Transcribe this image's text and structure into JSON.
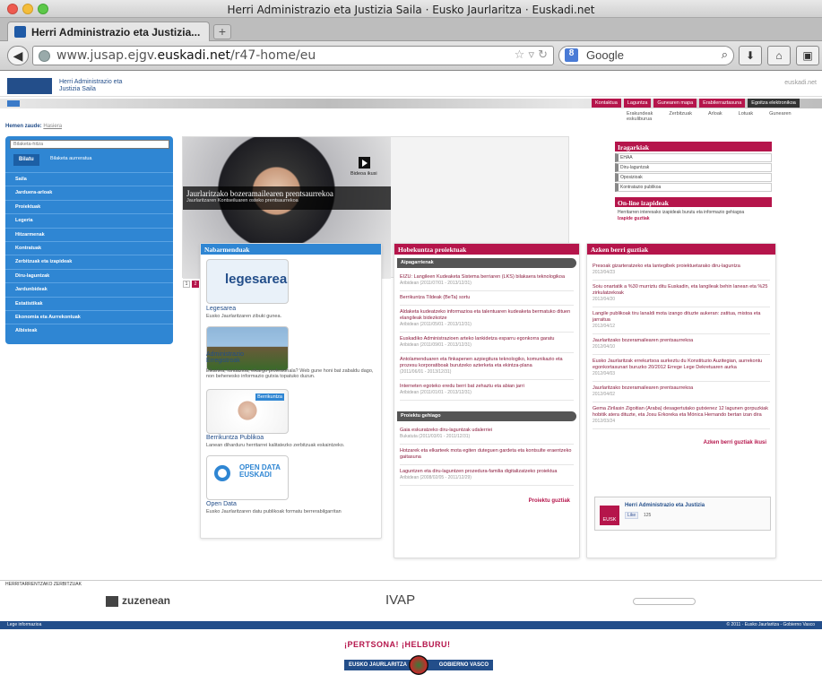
{
  "window": {
    "title": "Herri Administrazio eta Justizia Saila · Eusko Jaurlaritza · Euskadi.net"
  },
  "tab": {
    "label": "Herri Administrazio eta Justizia...",
    "new": "+"
  },
  "nav": {
    "url_prefix": "www.jusap.ejgv.",
    "url_domain": "euskadi.net",
    "url_path": "/r47-home/eu",
    "search_engine": "Google"
  },
  "header": {
    "org_name": "Herri Administrazio eta Justizia Saila",
    "brand_right": "euskadi.net"
  },
  "topnav": [
    "Kontaktua",
    "Laguntza",
    "Gunearen mapa",
    "Erabilerraztasuna",
    "Egoitza elektronikoa"
  ],
  "subnav": [
    "Erakundeak",
    "Zerbitzuak",
    "Arloak",
    "Lotuak",
    "Gunearen eskuliburua"
  ],
  "breadcrumb": {
    "label": "Hemen zaude:",
    "current": "Hasiera"
  },
  "sidebar": {
    "search_placeholder": "Bilaketa-hitza",
    "search_button": "Bilatu",
    "advanced": "Bilaketa aurreratua",
    "items": [
      "Saila",
      "Jarduera-arloak",
      "Proiektuak",
      "Legeria",
      "Hitzarmenak",
      "Kontratuak",
      "Zerbitzuak eta izapideak",
      "Diru-laguntzak",
      "Jardunbideak",
      "Estatistikak",
      "Ekonomia eta Aurrekontuak",
      "Albisteak"
    ]
  },
  "hero": {
    "title": "Jaurlaritzako bozeramailearen prentsaurrekoa",
    "subtitle": "Jaurlaritzaren Kontseiluaren osteko prentsaurrekoa",
    "video_label": "Bideoa ikusi",
    "pages": [
      "1",
      "2"
    ]
  },
  "right_panel": {
    "title1": "Iragarkiak",
    "items": [
      "EHAA",
      "Diru-laguntzak",
      "Oposizioak",
      "Kontratazio publikoa"
    ],
    "title2": "On-line izapideak",
    "online_text": "Herritarren interesako izapideak burutu eta informazio gehiagoa",
    "online_link": "Izapide guztiak"
  },
  "col1": {
    "title": "Nabarmenduak",
    "entries": [
      {
        "logo": "legesarea",
        "title": "Legesarea",
        "desc": "Eusko Jaurlaritzaren zibuki gunea."
      },
      {
        "title": "Administrazio Erregistroak",
        "desc": "Elkartea, fundazioa, elkargo profesionala? Web gune honi bat zabaldu dago, non behenesko informazio gutxia topatuko duzun."
      },
      {
        "tag": "Berrikuntza",
        "title": "Berrikuntza Publikoa",
        "desc": "Lanean diharduru herritarrei kalitatezko zerbitzuak eskaintzeko."
      },
      {
        "logo1": "OPEN DATA",
        "logo2": "EUSKADI",
        "title": "Open Data",
        "desc": "Eusko Jaurlaritzaren datu publikoak formatu berrerabilgarritan"
      }
    ]
  },
  "col2": {
    "title": "Hobekuntza proiektuak",
    "sub1": "Aipagarrienak",
    "items1": [
      {
        "text": "EIZU: Langileen Kudeaketa Sistema berriaren (LKS) bilakaera teknologikoa",
        "date": "Aribidean (2011/07/01 - 2013/12/31)"
      },
      {
        "text": "Berrikuntza Tildeak (BeTa) sortu",
        "date": ""
      },
      {
        "text": "Aldaketa kudeatzeko informazioa eta talentuaren kudeaketa bermatuko dituen elangileak bidezkotze",
        "date": "Aribidean (2011/05/01 - 2013/12/31)"
      },
      {
        "text": "Euskadiko Administrazioen arteko lankidetza esparru egonkorra garatu",
        "date": "Aribidean (2011/09/01 - 2013/12/31)"
      },
      {
        "text": "Antolamenduaren eta finkapenen azpiegitura teknologiko, komunikazio eta prozesu korporatiboak burutzeko azterketa eta ekintza-plana",
        "date": "(2011/06/01 - 2013/12/31)"
      },
      {
        "text": "Interneten egoteko eredu berri bat zehaztu eta abian jarri",
        "date": "Aribidean (2011/01/01 - 2013/12/31)"
      }
    ],
    "sub2": "Proiektu gehiago",
    "items2": [
      {
        "text": "Gaia eskuratzeko diru-laguntzak udalerriei",
        "date": "Bukatuta (2011/03/01 - 2011/12/31)"
      },
      {
        "text": "Hotzarek eta elkarteek mota egiten duteguen gardeta eta kontsulte eraentzeko gaitasuna",
        "date": ""
      },
      {
        "text": "Laguntzen eta diru-laguntzen prozedura-familia digitalizatzeko proiektua",
        "date": "Aribidean (2008/02/05 - 2011/12/29)"
      }
    ],
    "more": "Proiektu guztiak"
  },
  "col3": {
    "title": "Azken berri guztiak",
    "items": [
      {
        "text": "Presoak gizarteratzeko eta lantegibek proiektuetarako diru-laguntza",
        "date": "2012/04/23"
      },
      {
        "text": "Soiu onartatik a %30 murriztu ditu Euskadin, eta langileak behin lanean eta %25 zirkulatzekoak",
        "date": "2012/04/20"
      },
      {
        "text": "Langile publikoak tiru lanaldi mota izango dituzte aukeran: zatitua, mistoa eta jarraitua",
        "date": "2012/04/12"
      },
      {
        "text": "Jaurlaritzako bozeramailearen prentsaurrekoa",
        "date": "2012/04/10"
      },
      {
        "text": "Eusko Jaurlaritzak errekurtsoa aurkeztu du Konstituzio Auzitegian, aurrekontu egonkortasunari buruzko 20/2012 Errege Lege Dekretuaren aurka",
        "date": "2012/04/03"
      },
      {
        "text": "Jaurlaritzako bozeramailearen prentsaurrekoa",
        "date": "2012/04/02"
      },
      {
        "text": "Gema Zirilasin Zigoitian (Araba) desagertutako gutxienez 12 lagunen gorpuzkiak hobitik atera dituzte, eta Josu Erkoreka eta Mónica Hernando bertan izan dira",
        "date": "2012/03/24"
      }
    ],
    "more": "Azken berri guztiak ikusi",
    "fb_name": "Herri Administrazio eta Justizia",
    "fb_logo": "EUSK",
    "fb_like": "Like",
    "fb_count": "125"
  },
  "footer": {
    "section": "HERRITARRENTZAKO ZERBITZUAK",
    "logo1": "zuzenean",
    "logo2": "IVAP",
    "blue_left": "Lege informazioa",
    "blue_right": "© 2011 · Eusko Jaurlaritza - Gobierno Vasco",
    "slogan": "¡PERTSONA! ¡HELBURU!",
    "gv_left": "EUSKO JAURLARITZA",
    "gv_right": "GOBIERNO VASCO"
  },
  "colors": {
    "accent": "#b5154b",
    "brand_blue": "#2f86d3",
    "dark_blue": "#234e8a"
  }
}
